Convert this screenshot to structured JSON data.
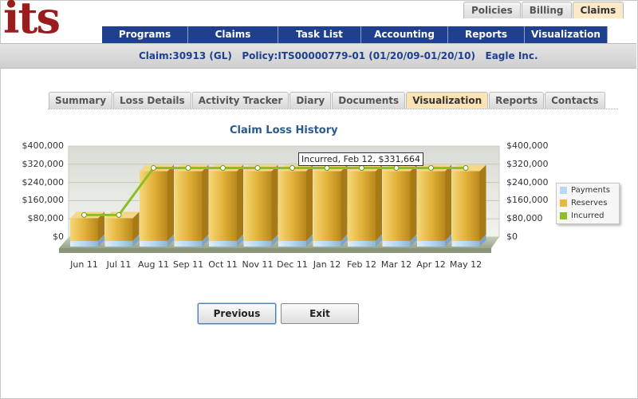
{
  "logo": "its",
  "top_tabs": [
    {
      "label": "Policies",
      "active": false
    },
    {
      "label": "Billing",
      "active": false
    },
    {
      "label": "Claims",
      "active": true
    }
  ],
  "nav": [
    "Programs",
    "Claims",
    "Task List",
    "Accounting",
    "Reports",
    "Visualization"
  ],
  "claim_bar": {
    "text": "Claim:30913 (GL)   Policy:ITS00000779-01 (01/20/09-01/20/10)   Eagle Inc."
  },
  "sub_tabs": [
    {
      "label": "Summary",
      "active": false
    },
    {
      "label": "Loss Details",
      "active": false
    },
    {
      "label": "Activity Tracker",
      "active": false
    },
    {
      "label": "Diary",
      "active": false
    },
    {
      "label": "Documents",
      "active": false
    },
    {
      "label": "Visualization",
      "active": true
    },
    {
      "label": "Reports",
      "active": false
    },
    {
      "label": "Contacts",
      "active": false
    }
  ],
  "tooltip": "Incurred, Feb 12, $331,664",
  "buttons": {
    "previous": "Previous",
    "exit": "Exit"
  },
  "colors": {
    "nav": "#1f3f8f",
    "payments": "#b7d9ef",
    "reserves": "#e8b83a",
    "incurred": "#8dbf22",
    "logo": "#9b1c1c"
  },
  "chart_data": {
    "type": "bar",
    "title": "Claim Loss History",
    "categories": [
      "Jun 11",
      "Jul 11",
      "Aug 11",
      "Sep 11",
      "Oct 11",
      "Nov 11",
      "Dec 11",
      "Jan 12",
      "Feb 12",
      "Mar 12",
      "Apr 12",
      "May 12"
    ],
    "yticks": [
      "$400,000",
      "$320,000",
      "$240,000",
      "$160,000",
      "$80,000",
      "$0"
    ],
    "ylim": [
      0,
      400000
    ],
    "stacked": true,
    "series": [
      {
        "name": "Payments",
        "type": "bar",
        "values": [
          25000,
          25000,
          25000,
          25000,
          25000,
          25000,
          25000,
          25000,
          25000,
          25000,
          25000,
          25000
        ]
      },
      {
        "name": "Reserves",
        "type": "bar",
        "values": [
          100000,
          100000,
          306664,
          306664,
          306664,
          306664,
          306664,
          306664,
          306664,
          306664,
          306664,
          306664
        ]
      },
      {
        "name": "Incurred",
        "type": "line",
        "values": [
          125000,
          125000,
          331664,
          331664,
          331664,
          331664,
          331664,
          331664,
          331664,
          331664,
          331664,
          331664
        ]
      }
    ],
    "legend_position": "right"
  }
}
